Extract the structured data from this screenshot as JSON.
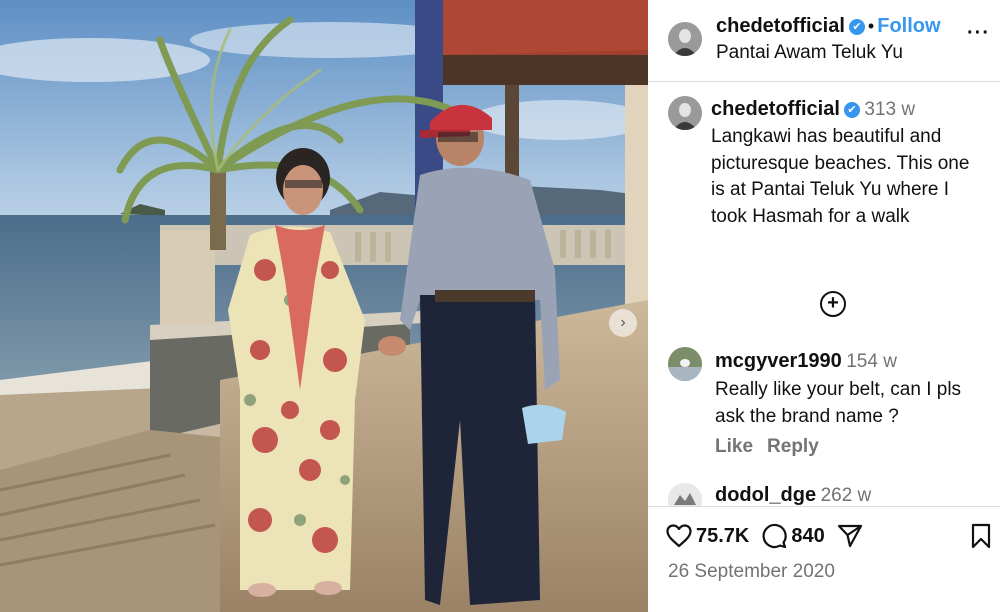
{
  "header": {
    "username": "chedetofficial",
    "verified_mark": "✔",
    "separator": "•",
    "follow_label": "Follow",
    "location": "Pantai Awam Teluk Yu",
    "more_label": "···"
  },
  "caption": {
    "username": "chedetofficial",
    "age": "313 w",
    "text": "Langkawi has beautiful and picturesque  beaches. This one is at Pantai Teluk Yu where I took Hasmah for a walk"
  },
  "load_more_label": "+",
  "comments": [
    {
      "username": "mcgyver1990",
      "age": "154 w",
      "text": "Really like your belt, can I pls ask the brand name ?",
      "like_label": "Like",
      "reply_label": "Reply"
    },
    {
      "username": "dodol_dge",
      "age": "262 w"
    }
  ],
  "stats": {
    "likes": "75.7K",
    "comments": "840"
  },
  "post_date": "26 September 2020",
  "photo_next_label": "›",
  "icons": {
    "heart": "heart-icon",
    "comment": "comment-icon",
    "share": "share-icon",
    "bookmark": "bookmark-icon",
    "verified": "verified-icon"
  },
  "colors": {
    "accent": "#3797f0",
    "muted": "#737373",
    "divider": "#dbdbdb"
  }
}
